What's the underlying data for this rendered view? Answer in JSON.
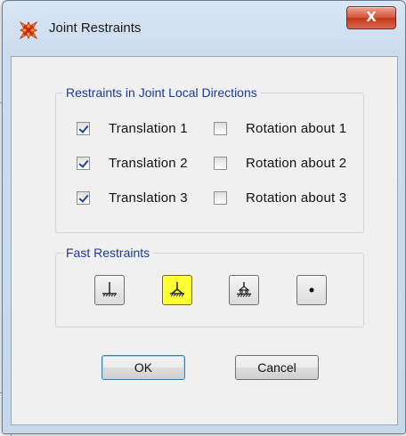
{
  "window": {
    "title": "Joint Restraints",
    "close_label": "X"
  },
  "restraints": {
    "group_title": "Restraints in Joint Local Directions",
    "translations": [
      {
        "label": "Translation  1",
        "checked": true
      },
      {
        "label": "Translation  2",
        "checked": true
      },
      {
        "label": "Translation  3",
        "checked": true
      }
    ],
    "rotations": [
      {
        "label": "Rotation about  1",
        "checked": false
      },
      {
        "label": "Rotation about  2",
        "checked": false
      },
      {
        "label": "Rotation about  3",
        "checked": false
      }
    ]
  },
  "fast_restraints": {
    "group_title": "Fast Restraints",
    "buttons": [
      {
        "icon": "fixed-support-icon",
        "active": false
      },
      {
        "icon": "pinned-support-icon",
        "active": true
      },
      {
        "icon": "roller-support-icon",
        "active": false
      },
      {
        "icon": "free-joint-icon",
        "active": false
      }
    ]
  },
  "actions": {
    "ok_label": "OK",
    "cancel_label": "Cancel"
  },
  "colors": {
    "group_title": "#1c3a95",
    "active_restraint": "#ffff33",
    "close_button": "#c5381f"
  }
}
